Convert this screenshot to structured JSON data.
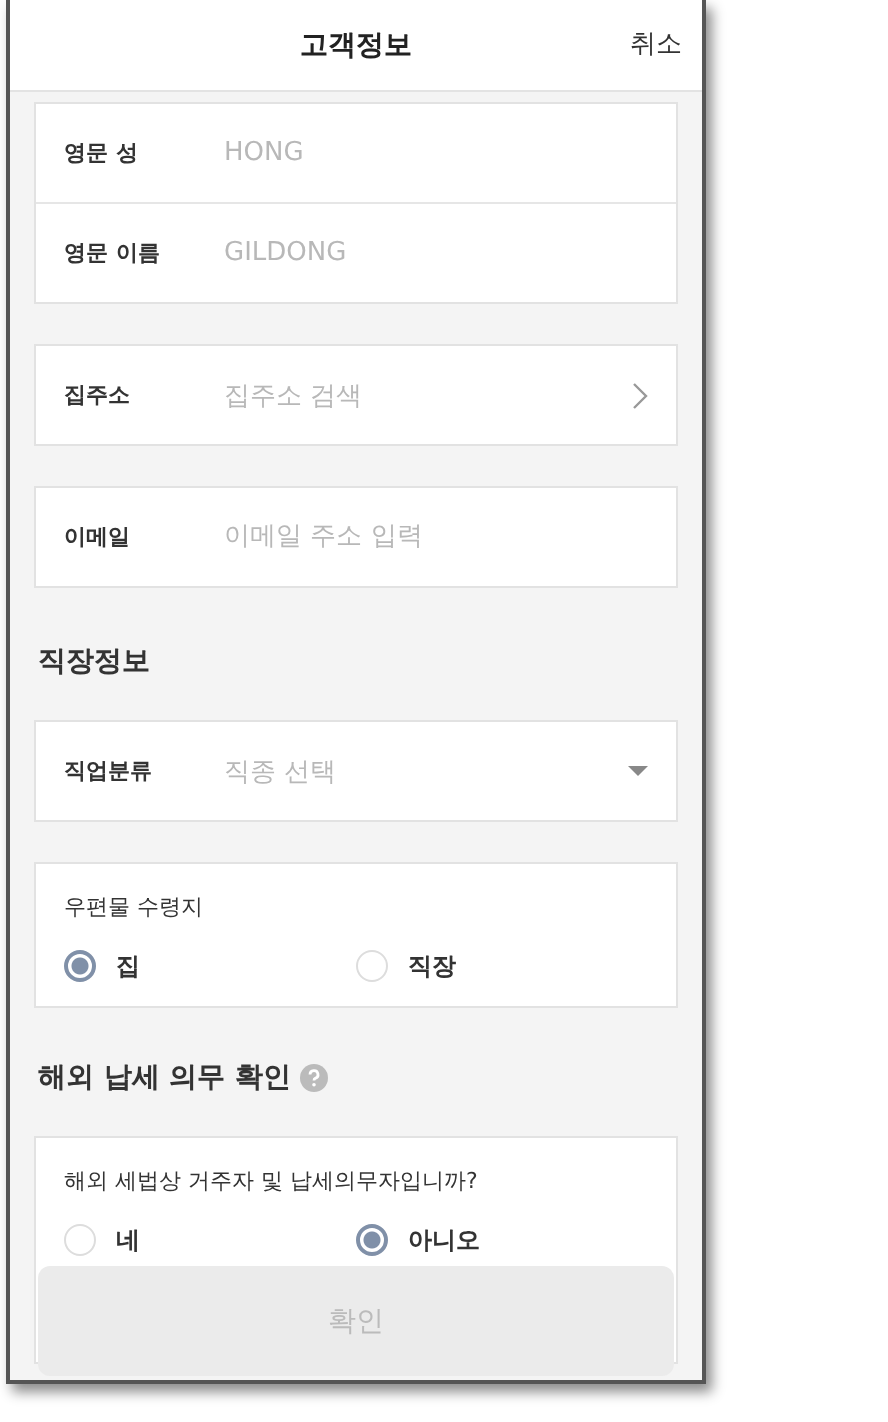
{
  "header": {
    "title": "고객정보",
    "cancel": "취소"
  },
  "groups": [
    {
      "fields": [
        {
          "kind": "input",
          "label": "영문 성",
          "placeholder": "HONG"
        },
        {
          "kind": "input",
          "label": "영문 이름",
          "placeholder": "GILDONG"
        }
      ]
    },
    {
      "fields": [
        {
          "kind": "link",
          "label": "집주소",
          "placeholder": "집주소 검색"
        }
      ]
    },
    {
      "fields": [
        {
          "kind": "input",
          "label": "이메일",
          "placeholder": "이메일 주소 입력"
        }
      ]
    },
    {
      "title": "직장정보",
      "fields": [
        {
          "kind": "select",
          "label": "직업분류",
          "placeholder": "직종 선택"
        }
      ]
    }
  ],
  "mail": {
    "label": "우편물 수령지",
    "options": [
      {
        "label": "집",
        "selected": true
      },
      {
        "label": "직장",
        "selected": false
      }
    ]
  },
  "tax": {
    "title": "해외 납세 의무 확인",
    "question": "해외 세법상 거주자 및 납세의무자입니까?",
    "options": [
      {
        "label": "네",
        "selected": false
      },
      {
        "label": "아니오",
        "selected": true
      }
    ]
  },
  "confirm": {
    "label": "확인",
    "disabled": true
  }
}
